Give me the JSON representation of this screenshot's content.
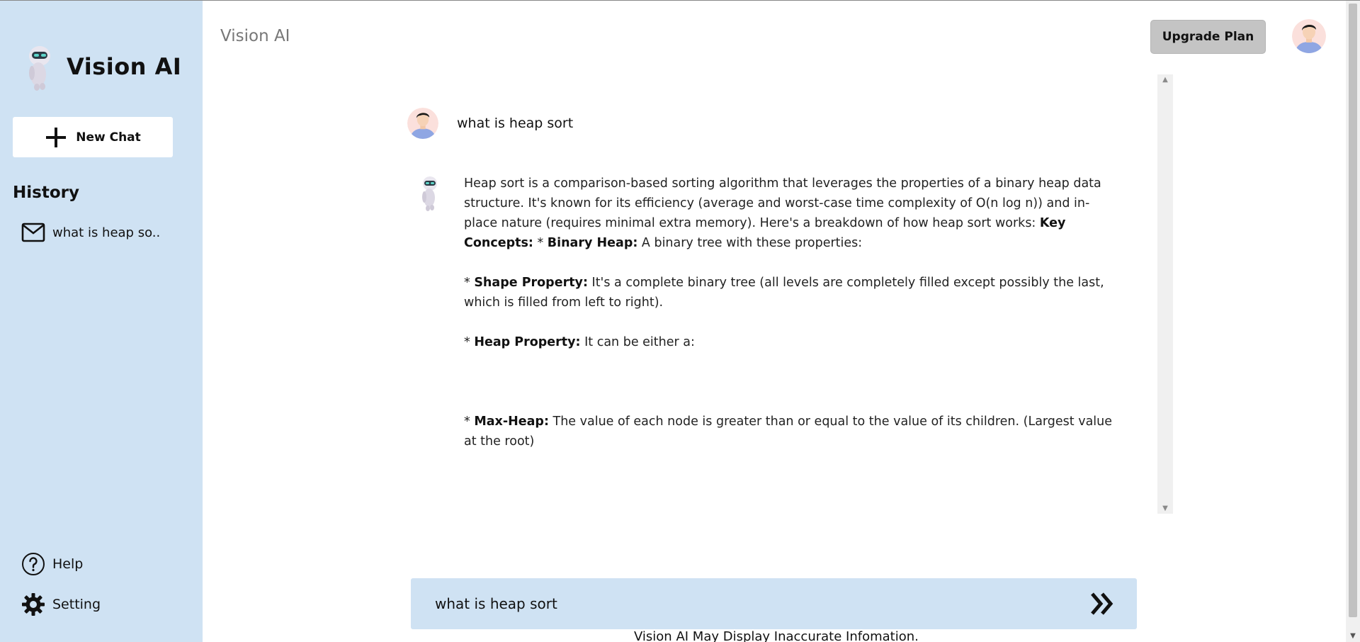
{
  "sidebar": {
    "brand": "Vision AI",
    "new_chat_label": "New Chat",
    "history_title": "History",
    "history_items": [
      {
        "label": "what is heap so.."
      }
    ],
    "help_label": "Help",
    "setting_label": "Setting"
  },
  "header": {
    "title": "Vision AI",
    "upgrade_label": "Upgrade Plan"
  },
  "chat": {
    "user_message": "what is heap sort",
    "bot_message": {
      "intro": "Heap sort is a comparison-based sorting algorithm that leverages the properties of a binary heap data structure. It's known for its efficiency (average and worst-case time complexity of O(n log n)) and in-place nature (requires minimal extra memory). Here's a breakdown of how heap sort works: ",
      "key_concepts": "Key Concepts:",
      "star1": " * ",
      "binary_heap": "Binary Heap:",
      "binary_heap_text": " A binary tree with these properties:",
      "shape_label": "Shape Property:",
      "shape_text": " It's a complete binary tree (all levels are completely filled except possibly the last, which is filled from left to right).",
      "heap_label": "Heap Property:",
      "heap_text": " It can be either a:",
      "maxheap_label": "Max-Heap:",
      "maxheap_text": " The value of each node is greater than or equal to the value of its children. (Largest value at the root)",
      "trailing": "*"
    }
  },
  "input": {
    "value": "what is heap sort"
  },
  "disclaimer": "Vision AI May Display Inaccurate Infomation.",
  "colors": {
    "sidebar_bg": "#cfe2f3",
    "input_bg": "#cfe2f3",
    "upgrade_bg": "#c4c4c4"
  },
  "icons": [
    "robot-logo",
    "plus-icon",
    "mail-icon",
    "help-icon",
    "gear-icon",
    "user-avatar",
    "bot-avatar",
    "send-icon"
  ]
}
